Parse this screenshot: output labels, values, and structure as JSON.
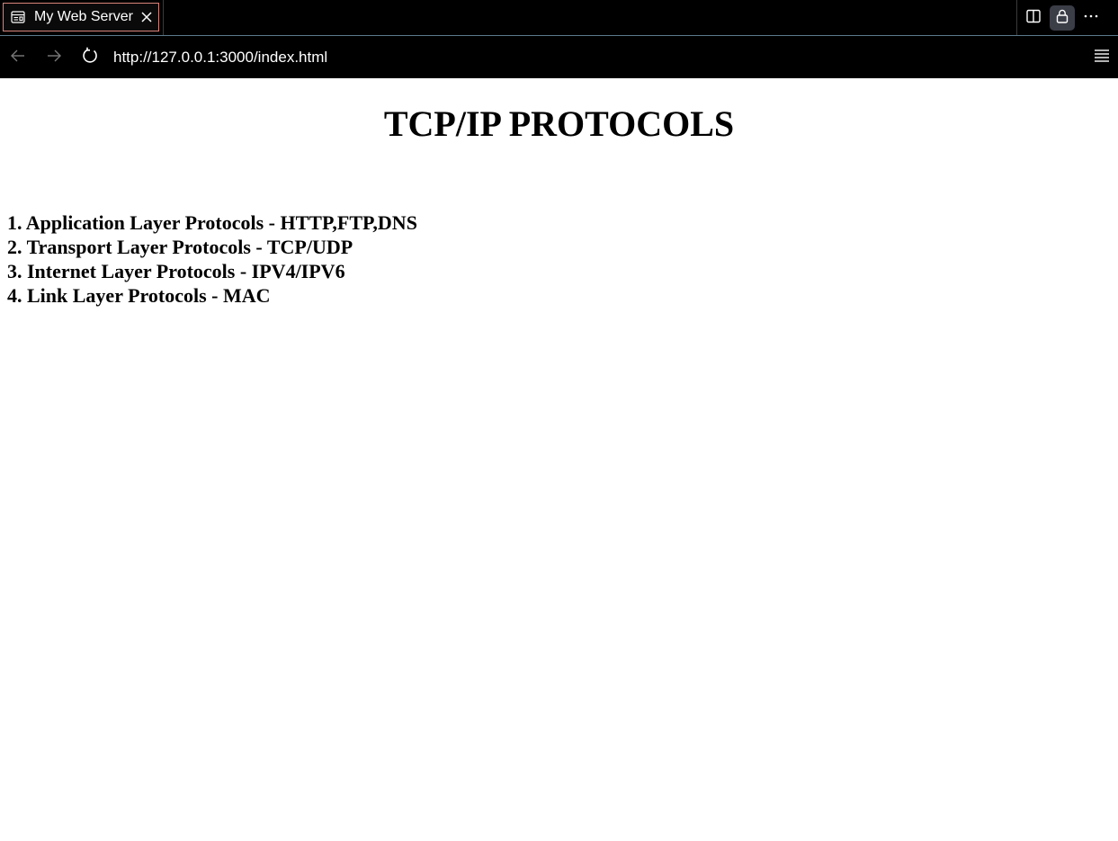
{
  "tab": {
    "title": "My Web Server",
    "icon": "web-page-icon"
  },
  "address_bar": {
    "url": "http://127.0.0.1:3000/index.html"
  },
  "page": {
    "heading": "TCP/IP PROTOCOLS",
    "items": [
      "1. Application Layer Protocols - HTTP,FTP,DNS",
      "2. Transport Layer Protocols - TCP/UDP",
      "3. Internet Layer Protocols - IPV4/IPV6",
      "4. Link Layer Protocols - MAC"
    ]
  },
  "colors": {
    "chrome_background": "#000000",
    "tab_border": "#d9837a",
    "page_background": "#ffffff",
    "page_text": "#000000"
  }
}
